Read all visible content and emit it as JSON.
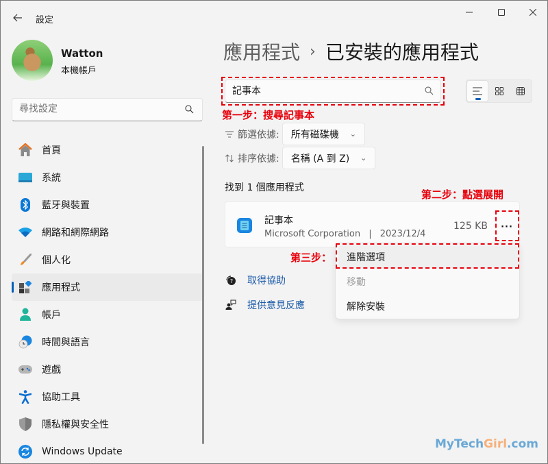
{
  "window": {
    "title": "設定",
    "controls": {
      "minimize": "minimize-icon",
      "maximize": "maximize-icon",
      "close": "close-icon"
    }
  },
  "profile": {
    "name": "Watton",
    "account_type": "本機帳戶"
  },
  "sidebar": {
    "search_placeholder": "尋找設定",
    "items": [
      {
        "label": "首頁",
        "icon": "home-icon"
      },
      {
        "label": "系統",
        "icon": "system-icon"
      },
      {
        "label": "藍牙與裝置",
        "icon": "bluetooth-icon"
      },
      {
        "label": "網路和網際網路",
        "icon": "wifi-icon"
      },
      {
        "label": "個人化",
        "icon": "brush-icon"
      },
      {
        "label": "應用程式",
        "icon": "apps-icon",
        "active": true
      },
      {
        "label": "帳戶",
        "icon": "account-icon"
      },
      {
        "label": "時間與語言",
        "icon": "time-language-icon"
      },
      {
        "label": "遊戲",
        "icon": "gamepad-icon"
      },
      {
        "label": "協助工具",
        "icon": "accessibility-icon"
      },
      {
        "label": "隱私權與安全性",
        "icon": "shield-icon"
      },
      {
        "label": "Windows Update",
        "icon": "windows-update-icon"
      }
    ]
  },
  "main": {
    "breadcrumb": {
      "parent": "應用程式",
      "separator": "›",
      "current": "已安裝的應用程式"
    },
    "search": {
      "value": "記事本"
    },
    "view_modes": [
      "list-view",
      "tile-view",
      "grid-view"
    ],
    "active_view": "list-view",
    "filter": {
      "label": "篩選依據:",
      "value": "所有磁碟機"
    },
    "sort": {
      "label": "排序依據:",
      "value": "名稱 (A 到 Z)"
    },
    "found_count": "找到 1 個應用程式",
    "apps": [
      {
        "name": "記事本",
        "publisher": "Microsoft Corporation",
        "separator": "|",
        "date": "2023/12/4",
        "size": "125 KB",
        "more": "···"
      }
    ],
    "context_menu": [
      {
        "label": "進階選項",
        "state": "hover"
      },
      {
        "label": "移動",
        "state": "disabled"
      },
      {
        "label": "解除安裝",
        "state": "normal"
      }
    ],
    "links": [
      {
        "label": "取得協助",
        "icon": "help-icon"
      },
      {
        "label": "提供意見反應",
        "icon": "feedback-icon"
      }
    ]
  },
  "annotations": {
    "step1": "第一步：搜尋記事本",
    "step2": "第二步：點選展開",
    "step3": "第三步：",
    "color": "#e8000b"
  },
  "watermark": {
    "part1": "MyTech",
    "part2": "Girl",
    "part3": ".com"
  }
}
